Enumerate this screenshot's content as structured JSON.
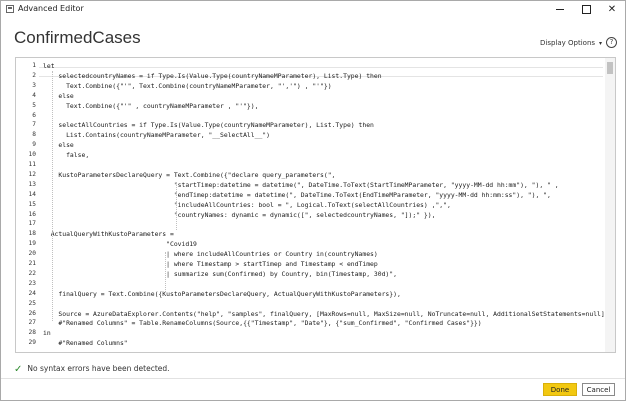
{
  "window": {
    "title": "Advanced Editor",
    "controls": {
      "minimize": "",
      "maximize": "",
      "close": "✕"
    }
  },
  "header": {
    "query_name": "ConfirmedCases",
    "display_options_label": "Display Options",
    "help_label": "?"
  },
  "editor": {
    "lines": [
      {
        "n": "1",
        "text": "let"
      },
      {
        "n": "2",
        "text": "    selectedcountryNames = if Type.Is(Value.Type(countryNameMParameter), List.Type) then"
      },
      {
        "n": "3",
        "text": "      Text.Combine({\"'\", Text.Combine(countryNameMParameter, \"','\") , \"'\"})"
      },
      {
        "n": "4",
        "text": "    else"
      },
      {
        "n": "5",
        "text": "      Text.Combine({\"'\" , countryNameMParameter , \"'\"}),"
      },
      {
        "n": "6",
        "text": ""
      },
      {
        "n": "7",
        "text": "    selectAllCountries = if Type.Is(Value.Type(countryNameMParameter), List.Type) then"
      },
      {
        "n": "8",
        "text": "      List.Contains(countryNameMParameter, \"__SelectAll__\")"
      },
      {
        "n": "9",
        "text": "    else"
      },
      {
        "n": "10",
        "text": "      false,"
      },
      {
        "n": "11",
        "text": ""
      },
      {
        "n": "12",
        "text": "    KustoParametersDeclareQuery = Text.Combine({\"declare query_parameters(\","
      },
      {
        "n": "13",
        "text": "                                  \"startTimep:datetime = datetime(\", DateTime.ToText(StartTimeMParameter, \"yyyy-MM-dd hh:mm\"), \"), \" ,"
      },
      {
        "n": "14",
        "text": "                                  \"endTimep:datetime = datetime(\", DateTime.ToText(EndTimeMParameter, \"yyyy-MM-dd hh:mm:ss\"), \"), \","
      },
      {
        "n": "15",
        "text": "                                  \"includeAllCountries: bool = \", Logical.ToText(selectAllCountries) ,\",\","
      },
      {
        "n": "16",
        "text": "                                  \"countryNames: dynamic = dynamic([\", selectedcountryNames, \"]);\" }),"
      },
      {
        "n": "17",
        "text": ""
      },
      {
        "n": "18",
        "text": "  ActualQueryWithKustoParameters ="
      },
      {
        "n": "19",
        "text": "                                \"Covid19"
      },
      {
        "n": "20",
        "text": "                                | where includeAllCountries or Country in(countryNames)"
      },
      {
        "n": "21",
        "text": "                                | where Timestamp > startTimep and Timestamp < endTimep"
      },
      {
        "n": "22",
        "text": "                                | summarize sum(Confirmed) by Country, bin(Timestamp, 30d)\","
      },
      {
        "n": "23",
        "text": ""
      },
      {
        "n": "24",
        "text": "    finalQuery = Text.Combine({KustoParametersDeclareQuery, ActualQueryWithKustoParameters}),"
      },
      {
        "n": "25",
        "text": ""
      },
      {
        "n": "26",
        "text": "    Source = AzureDataExplorer.Contents(\"help\", \"samples\", finalQuery, [MaxRows=null, MaxSize=null, NoTruncate=null, AdditionalSetStatements=null]),"
      },
      {
        "n": "27",
        "text": "    #\"Renamed Columns\" = Table.RenameColumns(Source,{{\"Timestamp\", \"Date\"}, {\"sum_Confirmed\", \"Confirmed Cases\"}})"
      },
      {
        "n": "28",
        "text": "in"
      },
      {
        "n": "29",
        "text": "    #\"Renamed Columns\""
      }
    ]
  },
  "status": {
    "message": "No syntax errors have been detected."
  },
  "footer": {
    "done_label": "Done",
    "cancel_label": "Cancel"
  },
  "colors": {
    "done_button": "#f2c811",
    "status_check": "#2e8b2e",
    "keyword": "#1a1aa6"
  }
}
